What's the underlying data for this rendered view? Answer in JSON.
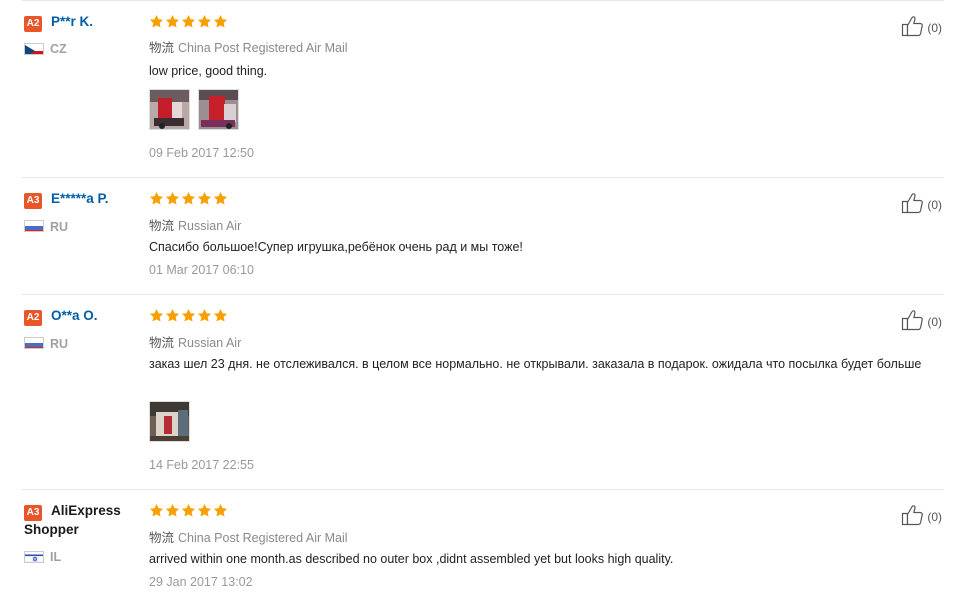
{
  "shipping_prefix": "物流",
  "reviews": [
    {
      "level": "A2",
      "name": "P**r K.",
      "country": "CZ",
      "stars": 5,
      "shipping": "China Post Registered Air Mail",
      "text": "low price, good thing.",
      "photos": [
        "photo",
        "photo"
      ],
      "date": "09 Feb 2017 12:50",
      "helpful": "(0)"
    },
    {
      "level": "A3",
      "name": "E*****a P.",
      "country": "RU",
      "stars": 5,
      "shipping": "Russian Air",
      "text": "Спасибо большое!Супер игрушка,ребёнок очень рад и мы тоже!",
      "photos": [],
      "date": "01 Mar 2017 06:10",
      "helpful": "(0)"
    },
    {
      "level": "A2",
      "name": "O**a O.",
      "country": "RU",
      "stars": 5,
      "shipping": "Russian Air",
      "text": "заказ шел 23 дня. не отслеживался. в целом все нормально. не открывали. заказала в подарок. ожидала что посылка будет больше",
      "photos": [
        "photo"
      ],
      "date": "14 Feb 2017 22:55",
      "helpful": "(0)"
    },
    {
      "level": "A3",
      "name": "AliExpress Shopper",
      "country": "IL",
      "stars": 5,
      "shipping": "China Post Registered Air Mail",
      "text": "arrived within one month.as described no outer box ,didnt assembled yet but looks high quality.",
      "photos": [],
      "date": "29 Jan 2017 13:02",
      "helpful": "(0)"
    }
  ],
  "colors": {
    "star": "#f7a000",
    "badge": "#e8562a",
    "name": "#005ea7"
  },
  "icons": {
    "rating": "star-icon",
    "helpful": "thumbs-up-icon"
  }
}
